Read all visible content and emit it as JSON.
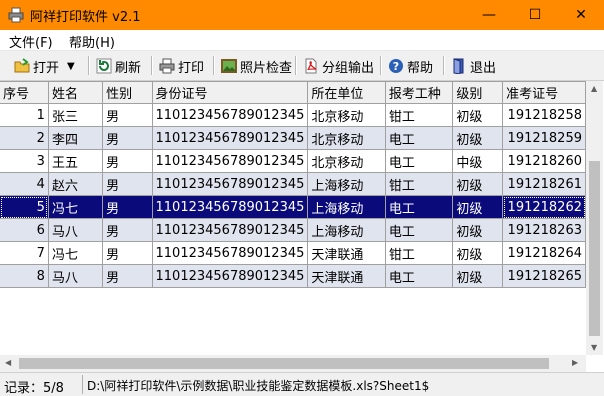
{
  "window": {
    "title": "阿祥打印软件 v2.1",
    "min": "—",
    "max": "☐",
    "close": "✕"
  },
  "menu": [
    {
      "label": "文件(F)"
    },
    {
      "label": "帮助(H)"
    }
  ],
  "toolbar": {
    "open": "打开",
    "dropdown": "▼",
    "refresh": "刷新",
    "print": "打印",
    "photo_check": "照片检查",
    "group_export": "分组输出",
    "help": "帮助",
    "exit": "退出"
  },
  "table": {
    "headers": [
      "序号",
      "姓名",
      "性别",
      "身份证号",
      "所在单位",
      "报考工种",
      "级别",
      "准考证号"
    ],
    "rows": [
      [
        "1",
        "张三",
        "男",
        "110123456789012345",
        "北京移动",
        "钳工",
        "初级",
        "191218258"
      ],
      [
        "2",
        "李四",
        "男",
        "110123456789012345",
        "北京移动",
        "电工",
        "初级",
        "191218259"
      ],
      [
        "3",
        "王五",
        "男",
        "110123456789012345",
        "北京移动",
        "电工",
        "中级",
        "191218260"
      ],
      [
        "4",
        "赵六",
        "男",
        "110123456789012345",
        "上海移动",
        "钳工",
        "初级",
        "191218261"
      ],
      [
        "5",
        "冯七",
        "男",
        "110123456789012345",
        "上海移动",
        "电工",
        "初级",
        "191218262"
      ],
      [
        "6",
        "马八",
        "男",
        "110123456789012345",
        "上海移动",
        "电工",
        "初级",
        "191218263"
      ],
      [
        "7",
        "冯七",
        "男",
        "110123456789012345",
        "天津联通",
        "钳工",
        "初级",
        "191218264"
      ],
      [
        "8",
        "马八",
        "男",
        "110123456789012345",
        "天津联通",
        "电工",
        "初级",
        "191218265"
      ]
    ],
    "selected_row": "5"
  },
  "status": {
    "record": "记录：5/8",
    "path": "D:\\阿祥打印软件\\示例数据\\职业技能鉴定数据模板.xls?Sheet1$"
  },
  "colors": {
    "titlebar": "#ff8a00",
    "selection": "#0a0a7a",
    "alt_row": "#e0e4ee"
  }
}
